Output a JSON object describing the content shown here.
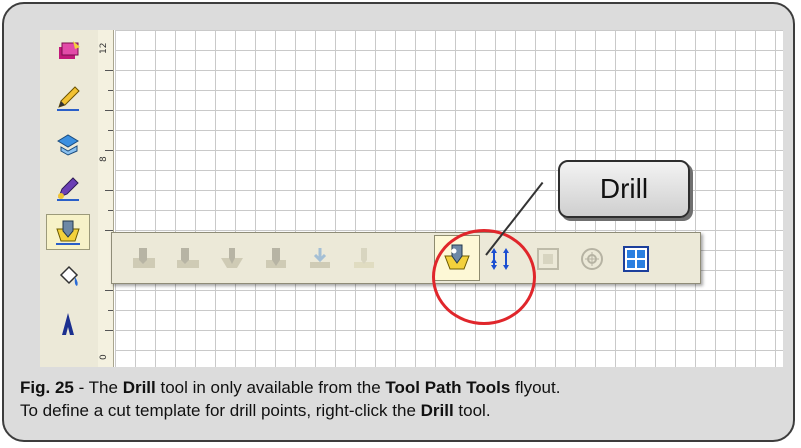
{
  "screenshot": {
    "ruler": {
      "labels": [
        "12",
        "8",
        "0"
      ]
    },
    "tool_column": {
      "icons": [
        "layer-cube-icon",
        "pencil-icon",
        "transform-icon",
        "pen-node-icon",
        "tool-path-icon",
        "paint-bucket-icon",
        "text-icon"
      ],
      "active_icon": "tool-path-icon"
    },
    "flyout": {
      "tools": [
        "profile-icon",
        "pocket-icon",
        "v-carve-icon",
        "engrave-icon",
        "drop-down-icon",
        "relief-icon",
        "drill-icon",
        "array-icon",
        "nest-icon",
        "circle-target-icon",
        "tiling-icon"
      ],
      "selected_tool": "drill-icon"
    },
    "callout": {
      "label": "Drill"
    }
  },
  "caption": {
    "line1": {
      "fig": "Fig. 25",
      "t1": " - The ",
      "b1": "Drill",
      "t2": " tool in only available from the ",
      "b2": "Tool Path Tools",
      "t3": " flyout."
    },
    "line2": {
      "t1": "To define a cut template for drill points, right-click the ",
      "b1": "Drill",
      "t2": " tool."
    }
  },
  "colors": {
    "frame_border": "#3d3d3d",
    "frame_fill": "#dcdcdc",
    "highlight_ring": "#e0262b",
    "toolbar_bg": "#ece9d8",
    "grid_line": "#c9c9c9"
  }
}
